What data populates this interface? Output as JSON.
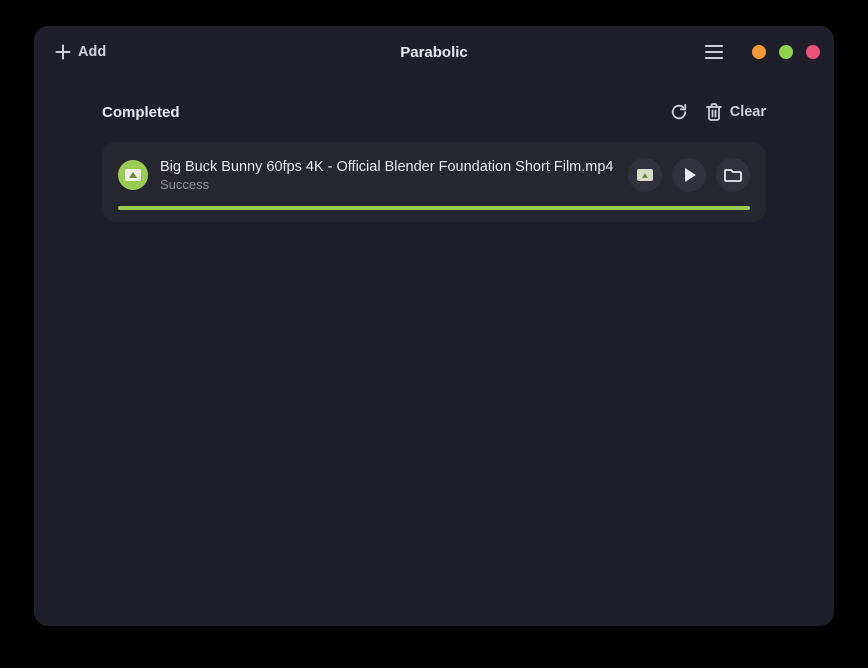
{
  "titlebar": {
    "add_label": "Add",
    "title": "Parabolic"
  },
  "section": {
    "title": "Completed",
    "clear_label": "Clear"
  },
  "downloads": [
    {
      "filename": "Big Buck Bunny 60fps 4K - Official Blender Foundation Short Film.mp4",
      "status": "Success",
      "progress": 100
    }
  ],
  "colors": {
    "accent": "#9ccb55"
  }
}
